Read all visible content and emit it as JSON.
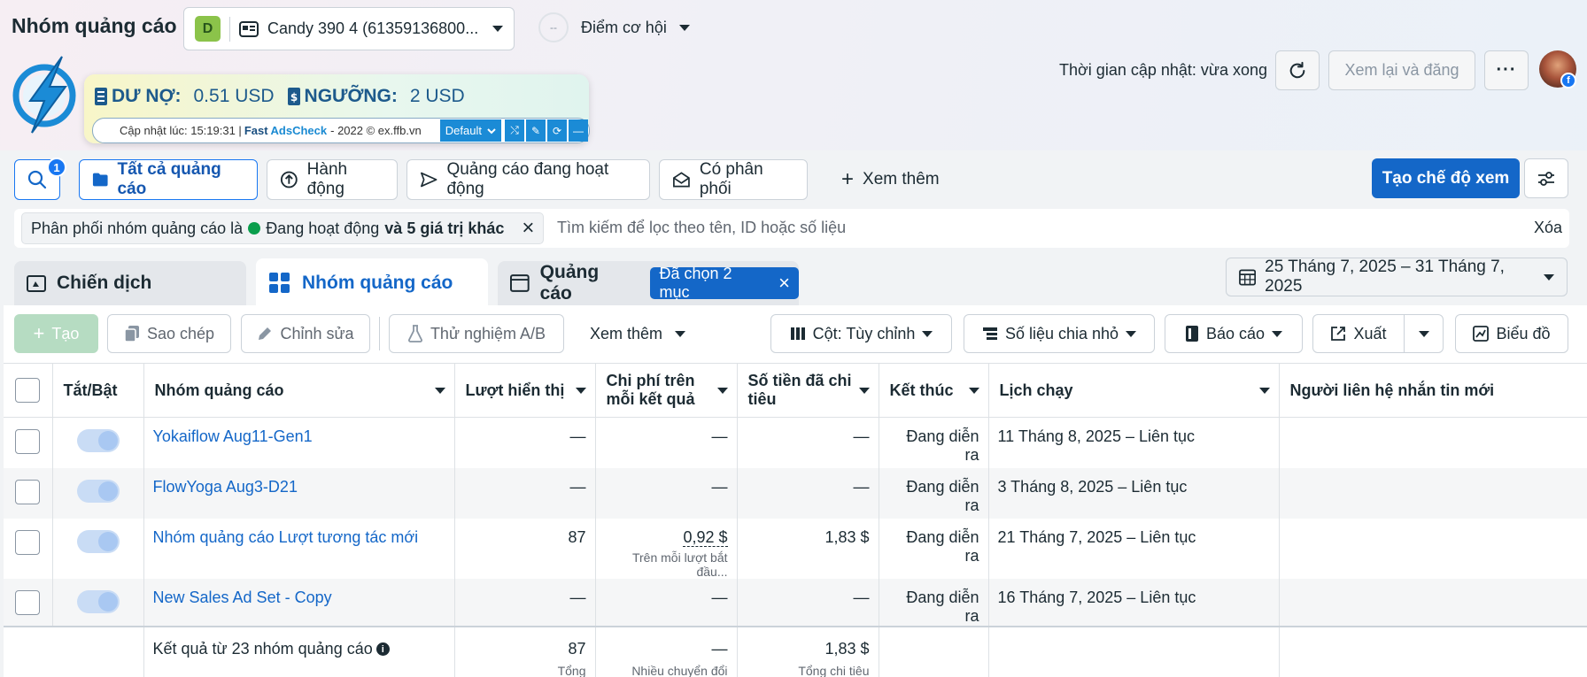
{
  "header": {
    "title": "Nhóm quảng cáo",
    "account_badge": "D",
    "account_name": "Candy 390 4 (61359136800...",
    "opportunity_circle": "--",
    "opportunity_label": "Điểm cơ hội",
    "update_time": "Thời gian cập nhật: vừa xong",
    "review_button": "Xem lại và đăng",
    "more_button": "···"
  },
  "adscheck": {
    "debt_label": "DƯ NỢ:",
    "debt_value": "0.51 USD",
    "threshold_label": "NGƯỠNG:",
    "threshold_value": "2 USD",
    "status_prefix": "Cập nhật lúc: 15:19:31 |",
    "brand_fast": "Fast",
    "brand_adscheck": "AdsCheck",
    "status_suffix": "- 2022 © ex.ffb.vn",
    "select_value": "Default",
    "colors": {
      "accent": "#1b8bd6",
      "text": "#1d5a8c"
    }
  },
  "toolbar_tabs": {
    "search_badge": "1",
    "all_ads": "Tất cả quảng cáo",
    "actions": "Hành động",
    "active_ads": "Quảng cáo đang hoạt động",
    "delivered": "Có phân phối",
    "see_more": "Xem thêm",
    "create_view": "Tạo chế độ xem"
  },
  "filter": {
    "chip_prefix": "Phân phối nhóm quảng cáo là",
    "chip_status": "Đang hoạt động",
    "chip_suffix": "và 5 giá trị khác",
    "search_placeholder": "Tìm kiếm để lọc theo tên, ID hoặc số liệu",
    "clear": "Xóa"
  },
  "levels": {
    "campaign": "Chiến dịch",
    "adset": "Nhóm quảng cáo",
    "ad": "Quảng cáo",
    "selected_chip": "Đã chọn 2 mục",
    "date_range": "25 Tháng 7, 2025 – 31 Tháng 7, 2025"
  },
  "actions_bar": {
    "create": "Tạo",
    "copy": "Sao chép",
    "edit": "Chỉnh sửa",
    "ab_test": "Thử nghiệm A/B",
    "more": "Xem thêm",
    "columns": "Cột: Tùy chỉnh",
    "breakdown": "Số liệu chia nhỏ",
    "report": "Báo cáo",
    "export": "Xuất",
    "chart": "Biểu đồ"
  },
  "table": {
    "headers": {
      "toggle": "Tắt/Bật",
      "name": "Nhóm quảng cáo",
      "impressions": "Lượt hiển thị",
      "cost_per_result": "Chi phí trên mỗi kết quả",
      "amount_spent": "Số tiền đã chi tiêu",
      "ends": "Kết thúc",
      "schedule": "Lịch chạy",
      "new_messaging": "Người liên hệ nhắn tin mới"
    },
    "rows": [
      {
        "name": "Yokaiflow Aug11-Gen1",
        "impressions": "—",
        "cpr": "—",
        "cpr_sub": "",
        "spent": "—",
        "ends": "Đang diễn ra",
        "schedule": "11 Tháng 8, 2025 – Liên tục"
      },
      {
        "name": "FlowYoga Aug3-D21",
        "impressions": "—",
        "cpr": "—",
        "cpr_sub": "",
        "spent": "—",
        "ends": "Đang diễn ra",
        "schedule": "3 Tháng 8, 2025 – Liên tục"
      },
      {
        "name": "Nhóm quảng cáo Lượt tương tác mới",
        "impressions": "87",
        "cpr": "0,92 $",
        "cpr_sub": "Trên mỗi lượt bắt đầu...",
        "spent": "1,83 $",
        "ends": "Đang diễn ra",
        "schedule": "21 Tháng 7, 2025 – Liên tục"
      },
      {
        "name": "New Sales Ad Set - Copy",
        "impressions": "—",
        "cpr": "—",
        "cpr_sub": "",
        "spent": "—",
        "ends": "Đang diễn ra",
        "schedule": "16 Tháng 7, 2025 – Liên tục"
      }
    ],
    "total": {
      "label": "Kết quả từ 23 nhóm quảng cáo",
      "impressions": "87",
      "impressions_sub": "Tổng",
      "cpr": "—",
      "cpr_sub": "Nhiều chuyển đổi",
      "spent": "1,83 $",
      "spent_sub": "Tổng chi tiêu"
    }
  }
}
